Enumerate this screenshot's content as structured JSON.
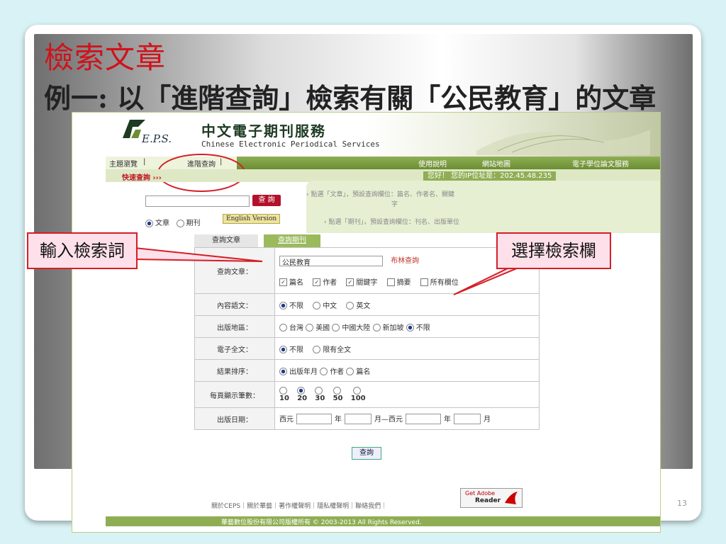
{
  "slide": {
    "title": "檢索文章",
    "subtitle": "例一: 以「進階查詢」檢索有關「公民教育」的文章",
    "page_number": "13"
  },
  "site": {
    "logo_text": "E.P.S.",
    "title": "中文電子期刊服務",
    "subtitle": "Chinese Electronic Periodical Services"
  },
  "nav": {
    "browse": "主題瀏覽",
    "advanced": "進階查詢",
    "help": "使用說明",
    "sitemap": "網站地圖",
    "thesis": "電子學位論文服務"
  },
  "quick": {
    "title": "快速查詢 ›››",
    "greeting": "您好！ 您的IP位址是：202.45.48.235",
    "search_button": "查 詢",
    "hint1": "› 點選「文章」，預設查詢欄位：篇名、作者名、關鍵",
    "hint1b": "字",
    "hint2": "› 點選「期刊」，預設查詢欄位：刊名、出版單位",
    "radio_article": "文章",
    "radio_journal": "期刊",
    "english_version": "English Version"
  },
  "tabs": {
    "article": "查詢文章",
    "journal": "查詢期刊"
  },
  "form": {
    "query_label": "查詢文章：",
    "query_value": "公民教育",
    "boolean_link": "布林查詢",
    "fields": [
      "篇名",
      "作者",
      "關鍵字",
      "摘要",
      "所有欄位"
    ],
    "language_label": "內容語文：",
    "language_opts": [
      "不限",
      "中文",
      "英文"
    ],
    "region_label": "出版地區：",
    "region_opts": [
      "台灣",
      "美國",
      "中國大陸",
      "新加坡",
      "不限"
    ],
    "fulltext_label": "電子全文：",
    "fulltext_opts": [
      "不限",
      "限有全文"
    ],
    "sort_label": "結果排序：",
    "sort_opts": [
      "出版年月",
      "作者",
      "篇名"
    ],
    "perpage_label": "每頁顯示筆數：",
    "perpage_opts": [
      "10",
      "20",
      "30",
      "50",
      "100"
    ],
    "date_label": "出版日期：",
    "date_parts": [
      "西元",
      "年",
      "月—西元",
      "年",
      "月"
    ],
    "submit": "查詢"
  },
  "footer": {
    "links": "關於CEPS｜關於華藝｜著作權聲明｜隱私權聲明｜聯絡我們｜",
    "adobe_top": "Get Adobe",
    "adobe_bottom": "Reader",
    "copyright": "華藝數位股份有限公司版權所有 © 2003-2013 All Rights Reserved."
  },
  "callouts": {
    "left": "輸入檢索詞",
    "right": "選擇檢索欄"
  },
  "colors": {
    "accent_red": "#d31f26",
    "green": "#8fae54",
    "title_red": "#d0121b"
  }
}
